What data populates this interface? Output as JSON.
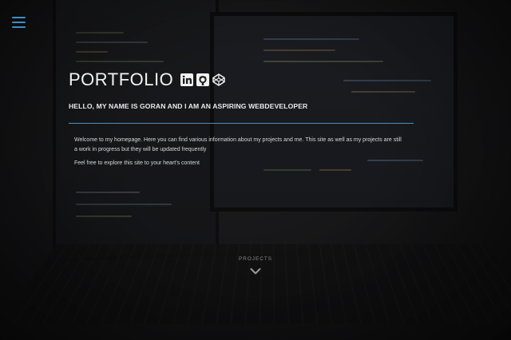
{
  "nav": {
    "menu_icon": "hamburger-menu-icon"
  },
  "hero": {
    "title": "PORTFOLIO",
    "social_icons": [
      "linkedin-icon",
      "github-icon",
      "codepen-icon"
    ],
    "subtitle": "HELLO, MY NAME IS GORAN AND I AM AN ASPIRING WEBDEVELOPER",
    "intro_paragraphs": [
      "Welcome to my homepage. Here you can find various information about my projects and me. This site as well as my projects are still a work in progress but they will be updated frequently",
      "Feel free to explore this site to your heart's content"
    ]
  },
  "scroll_link": {
    "label": "PROJECTS",
    "icon": "chevron-down-icon"
  },
  "colors": {
    "accent": "#3d8ec4",
    "rule": "#4a8fc2",
    "background": "#1d1d1e",
    "text": "#e9e9e9"
  }
}
